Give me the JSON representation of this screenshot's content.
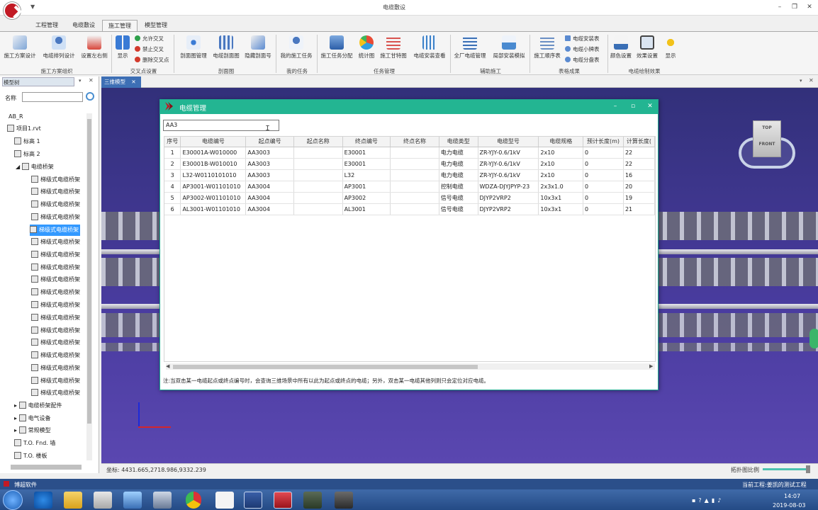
{
  "window": {
    "title": "电缆敷设"
  },
  "ribbon": {
    "tabs": [
      "工程管理",
      "电缆敷设",
      "施工管理",
      "模型管理"
    ],
    "active_tab": "施工管理",
    "buttons": [
      {
        "label": "施工方案设计",
        "icon": "design-plan-icon"
      },
      {
        "label": "电缆排列设计",
        "icon": "cable-arrange-icon"
      },
      {
        "label": "设置左右侧",
        "icon": "side-setting-icon"
      },
      {
        "label": "显示",
        "icon": "display-cross-icon"
      },
      {
        "label": "剖面图管理",
        "icon": "section-manage-icon"
      },
      {
        "label": "电缆剖面图",
        "icon": "cable-section-icon"
      },
      {
        "label": "隐藏剖面号",
        "icon": "hide-section-icon"
      },
      {
        "label": "我的施工任务",
        "icon": "my-task-icon"
      },
      {
        "label": "施工任务分配",
        "icon": "task-assign-icon"
      },
      {
        "label": "统计图",
        "icon": "pie-chart-icon"
      },
      {
        "label": "施工甘特图",
        "icon": "gantt-icon"
      },
      {
        "label": "电缆安装查看",
        "icon": "install-view-icon"
      },
      {
        "label": "全厂电缆管理",
        "icon": "plant-cable-icon"
      },
      {
        "label": "局部安装模拟",
        "icon": "local-sim-icon"
      },
      {
        "label": "施工顺序表",
        "icon": "sequence-table-icon"
      },
      {
        "label": "颜色设置",
        "icon": "color-setting-icon"
      },
      {
        "label": "效果设置",
        "icon": "effect-setting-icon"
      },
      {
        "label": "显示",
        "icon": "display-icon"
      }
    ],
    "cross_options": [
      {
        "label": "允许交叉",
        "color": "#2ea04a"
      },
      {
        "label": "禁止交叉",
        "color": "#d23a2c"
      },
      {
        "label": "删除交叉点",
        "color": "#d23a2c"
      }
    ],
    "table_options": [
      "电缆安装表",
      "电缆小牌表",
      "电缆分盘表"
    ],
    "groups": [
      "施工方案组织",
      "交叉点设置",
      "剖面图",
      "我的任务",
      "任务管理",
      "辅助施工",
      "表格成果",
      "电缆绘制效果"
    ]
  },
  "left_panel": {
    "tab": "模型树",
    "name_label": "名称",
    "tree": [
      {
        "label": "AB_R"
      },
      {
        "label": "项目1.rvt"
      },
      {
        "label": "标高 1"
      },
      {
        "label": "标高 2"
      },
      {
        "label": "电缆桥架"
      },
      {
        "label": "梯级式电缆桥架"
      },
      {
        "label": "梯级式电缆桥架"
      },
      {
        "label": "梯级式电缆桥架"
      },
      {
        "label": "梯级式电缆桥架"
      },
      {
        "label": "梯级式电缆桥架"
      },
      {
        "label": "梯级式电缆桥架"
      },
      {
        "label": "梯级式电缆桥架"
      },
      {
        "label": "梯级式电缆桥架"
      },
      {
        "label": "梯级式电缆桥架"
      },
      {
        "label": "梯级式电缆桥架"
      },
      {
        "label": "梯级式电缆桥架"
      },
      {
        "label": "梯级式电缆桥架"
      },
      {
        "label": "梯级式电缆桥架"
      },
      {
        "label": "梯级式电缆桥架"
      },
      {
        "label": "梯级式电缆桥架"
      },
      {
        "label": "梯级式电缆桥架"
      },
      {
        "label": "梯级式电缆桥架"
      },
      {
        "label": "梯级式电缆桥架"
      },
      {
        "label": "电缆桥架配件"
      },
      {
        "label": "电气设备"
      },
      {
        "label": "常规模型"
      },
      {
        "label": "T.O. Fnd. 墙"
      },
      {
        "label": "T.O. 楼板"
      }
    ]
  },
  "view": {
    "tab": "三维模型",
    "coords": "坐标: 4431.665,2718.986,9332.239",
    "scale_label": "拓扑图比例",
    "viewcube_top": "TOP",
    "viewcube_front": "FRONT"
  },
  "dialog": {
    "title": "电缆管理",
    "search_value": "AA3",
    "columns": [
      "序号",
      "电缆编号",
      "起点编号",
      "起点名称",
      "终点编号",
      "终点名称",
      "电缆类型",
      "电缆型号",
      "电缆规格",
      "预计长度(m)",
      "计算长度("
    ],
    "rows": [
      [
        "1",
        "E30001A-W010000",
        "AA3003",
        "",
        "E30001",
        "",
        "电力电缆",
        "ZR-YJY-0.6/1kV",
        "2x10",
        "0",
        "22"
      ],
      [
        "2",
        "E30001B-W010010",
        "AA3003",
        "",
        "E30001",
        "",
        "电力电缆",
        "ZR-YJY-0.6/1kV",
        "2x10",
        "0",
        "22"
      ],
      [
        "3",
        "L32-W0110101010",
        "AA3003",
        "",
        "L32",
        "",
        "电力电缆",
        "ZR-YJY-0.6/1kV",
        "2x10",
        "0",
        "16"
      ],
      [
        "4",
        "AP3001-W01101010",
        "AA3004",
        "",
        "AP3001",
        "",
        "控制电缆",
        "WDZA-DJYJPYP-23",
        "2x3x1.0",
        "0",
        "20"
      ],
      [
        "5",
        "AP3002-W01101010",
        "AA3004",
        "",
        "AP3002",
        "",
        "信号电缆",
        "DJYP2VRP2",
        "10x3x1",
        "0",
        "19"
      ],
      [
        "6",
        "AL3001-W01101010",
        "AA3004",
        "",
        "AL3001",
        "",
        "信号电缆",
        "DJYP2VRP2",
        "10x3x1",
        "0",
        "21"
      ]
    ],
    "note": "注:当双击某一电缆起点或终点编号时，会查询三维场景中所有以此为起点或终点的电缆；另外，双击某一电缆其他列则只会定位对应电缆。"
  },
  "status": {
    "left": "博超软件",
    "right": "当前工程:姜凯的测试工程"
  },
  "clock": {
    "time": "14:07",
    "date": "2019-08-03"
  }
}
